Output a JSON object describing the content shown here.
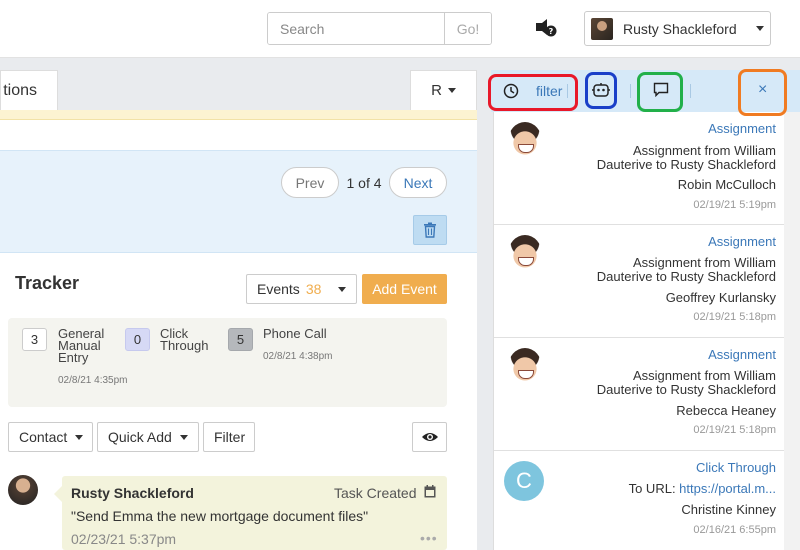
{
  "header": {
    "search_placeholder": "Search",
    "go_label": "Go!",
    "user_name": "Rusty Shackleford"
  },
  "left": {
    "tab_label": "tions",
    "r_button_label": "R",
    "pager": {
      "prev": "Prev",
      "info": "1 of 4",
      "next": "Next"
    },
    "tracker_title": "Tracker",
    "events_label": "Events",
    "events_count": "38",
    "add_event_label": "Add Event",
    "stats": [
      {
        "count": "3",
        "label_lines": [
          "General",
          "Manual",
          "Entry"
        ],
        "date": "02/8/21 4:35pm"
      },
      {
        "count": "0",
        "label_lines": [
          "Click",
          "Through"
        ],
        "date": ""
      },
      {
        "count": "5",
        "label_lines": [
          "Phone Call"
        ],
        "date": "02/8/21 4:38pm"
      }
    ],
    "filter_buttons": {
      "contact": "Contact",
      "quick_add": "Quick Add",
      "filter": "Filter"
    },
    "task": {
      "author": "Rusty Shackleford",
      "type": "Task Created",
      "body": "\"Send Emma the new mortgage document files\"",
      "time": "02/23/21 5:37pm",
      "more": "•••"
    }
  },
  "right_panel": {
    "filter_label": "filter",
    "close_label": "×",
    "items": [
      {
        "type": "Assignment",
        "desc_lines": [
          "Assignment from William",
          "Dauterive to Rusty Shackleford"
        ],
        "name": "Robin McCulloch",
        "time": "02/19/21 5:19pm"
      },
      {
        "type": "Assignment",
        "desc_lines": [
          "Assignment from William",
          "Dauterive to Rusty Shackleford"
        ],
        "name": "Geoffrey Kurlansky",
        "time": "02/19/21 5:18pm"
      },
      {
        "type": "Assignment",
        "desc_lines": [
          "Assignment from William",
          "Dauterive to Rusty Shackleford"
        ],
        "name": "Rebecca Heaney",
        "time": "02/19/21 5:18pm"
      },
      {
        "type": "Click Through",
        "url_prefix": "To URL: ",
        "url": "https://portal.m...",
        "avatar_letter": "C",
        "name": "Christine Kinney",
        "time": "02/16/21 6:55pm"
      }
    ]
  },
  "colors": {
    "accent_blue": "#3b78b8",
    "add_event_orange": "#f0ad4e",
    "highlight_red": "#e8182a",
    "highlight_blue": "#1a3fc8",
    "highlight_green": "#22b04a",
    "highlight_orange": "#f07b22"
  }
}
